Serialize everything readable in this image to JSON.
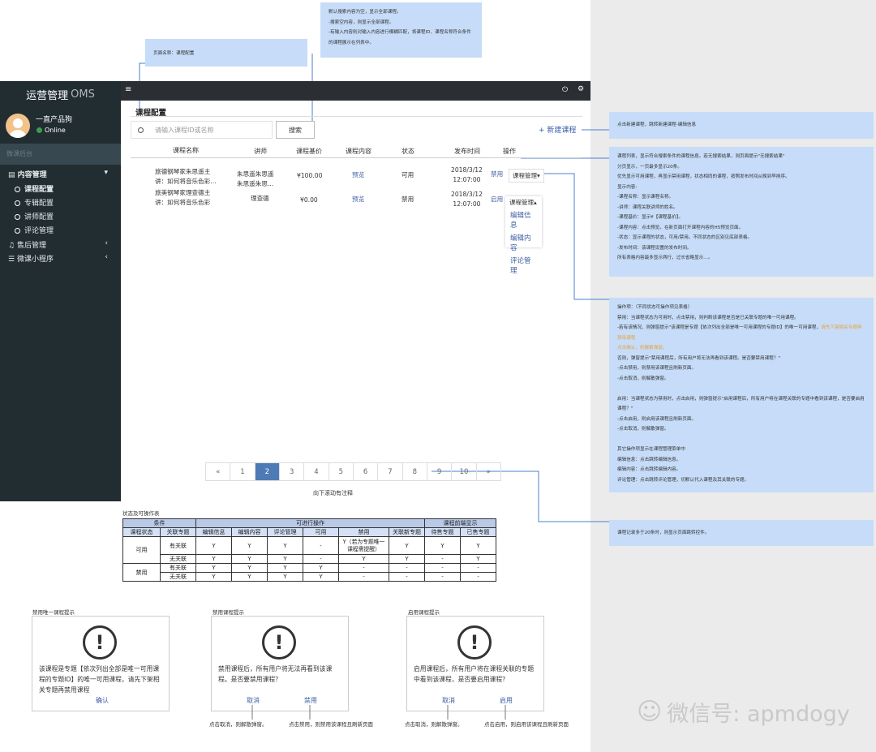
{
  "notes": {
    "search_note": "默认搜索内容为空，显示全部课程。\n-搜索空内容，则显示全部课程。\n-有输入内容则对输入内容进行模糊匹配，将课程ID、课程名称符合条件的课程展示在列表中。",
    "page_name_note": "页面名称：课程配置",
    "new_note": "点击新建课程，跳转新建课程-编辑信息",
    "list_note": "课程列表，显示符合搜索条件的课程信息。若无搜索结果，则页面提示\"无搜索结果\"\n分页显示，一页最多显示20条。\n优先显示可用课程，再显示禁用课程，状态相同的课程，按照发布时间从晚到早排序。\n显示内容:\n-课程名称：显示课程名称。\n-讲师：课程关联讲师的姓名。\n-课程基价：显示¥【课程基价】。\n-课程内容：点击预览，在新页面打开课程内容的H5预览页面。\n-状态：显示课程的状态，可用/禁用。不同状态的区别见底部表格。\n-发布时间：该课程设置的发布时间。\n所有表格内容最多显示两行，过长省略显示...。",
    "ops_note_intro": "操作项：（不同状态可操作项见表格）\n禁用：当课程状态为可用时，点击禁用，则判断该课程是否是已关联专题的唯一可用课程。\n-若有该情况，则弹窗提示\"该课程是专题【依次列出全部是唯一可用课程的专题ID】的唯一可用课程，",
    "ops_note_orange_1": "请先下架相关专题再禁用课程",
    "ops_note_orange_2": "点击确认，则解散弹窗。",
    "ops_note_rest": "否则，弹窗提示\"禁用课程后，所有用户将无法再看到该课程。是否要禁用课程？\"\n-点击禁用，则禁用该课程且刷新页面。\n-点击取消，则解散弹窗。\n\n启用：当课程状态为禁用时，点击启用，则弹窗提示\"启用课程后，所有用户将在课程关联的专题中看到该课程，是否要启用课程？\"\n-点击启用，则启用该课程且刷新页面。\n-点击取消，则解散弹窗。\n\n其它操作项显示在课程管理菜单中\n编辑信息：点击跳转编辑信息。\n编辑内容：点击跳转编辑内容。\n评论管理：点击跳转评论管理，切默认代入课程及其关联的专题。",
    "pager_note": "课程记录多于20条时，则显示页面跳转控件。"
  },
  "sidebar": {
    "brand": "运营管理",
    "brand_sub": "OMS",
    "user_name": "一直产品狗",
    "user_status": "Online",
    "search_placeholder": "微课后台",
    "group_content": "内容管理",
    "items": [
      "课程配置",
      "专辑配置",
      "讲师配置",
      "评论管理"
    ],
    "group_after_sales": "售后管理",
    "group_mini_program": "微课小程序"
  },
  "topbar": {
    "menu_icon": "≡",
    "power_icon": "⏻",
    "settings_icon": "⚙"
  },
  "page": {
    "title": "课程配置",
    "search_placeholder": "请输入课程ID或名称",
    "search_button": "搜索",
    "new_button": "+ 新建课程"
  },
  "table": {
    "headers": [
      "课程名称",
      "讲师",
      "课程基价",
      "课程内容",
      "状态",
      "发布时间",
      "操作"
    ],
    "rows": [
      {
        "name_l1": "旅德钢琴家朱思遥主",
        "name_l2": "讲：如何将音乐色彩...",
        "lecturer_l1": "朱思遥朱思遥",
        "lecturer_l2": "朱思遥朱思...",
        "price": "¥100.00",
        "content": "预览",
        "status": "可用",
        "date": "2018/3/12",
        "time": "12:07:00",
        "toggle": "禁用",
        "manage": "课程管理▾"
      },
      {
        "name_l1": "旅美钢琴家理查德主",
        "name_l2": "讲：如何将音乐色彩",
        "lecturer_l1": "理查德",
        "lecturer_l2": "",
        "price": "¥0.00",
        "content": "预览",
        "status": "禁用",
        "date": "2018/3/12",
        "time": "12:07:00",
        "toggle": "启用",
        "manage": "课程管理▴"
      }
    ],
    "manage_menu": [
      "编辑信息",
      "编辑内容",
      "评论管理"
    ]
  },
  "pagination": {
    "prev": "«",
    "pages": [
      "1",
      "2",
      "3",
      "4",
      "5",
      "6",
      "7",
      "8",
      "9",
      "10"
    ],
    "next": "»",
    "current": "2"
  },
  "scroll_hint": "向下滚动有注释",
  "state_table": {
    "title": "状态及可操作表",
    "group_headers": [
      "条件",
      "可进行操作",
      "课程前端显示"
    ],
    "col_headers": [
      "课程状态",
      "关联专题",
      "编辑信息",
      "编辑内容",
      "评论管理",
      "可用",
      "禁用",
      "关联新专题",
      "待售专题",
      "已售专题"
    ],
    "rows": [
      {
        "status": "可用",
        "assoc": "有关联",
        "cells": [
          "Y",
          "Y",
          "Y",
          "-",
          "Y（若为专题唯一课程需提醒）",
          "Y",
          "Y",
          "Y"
        ]
      },
      {
        "status": "",
        "assoc": "无关联",
        "cells": [
          "Y",
          "Y",
          "Y",
          "-",
          "Y",
          "Y",
          "-",
          "Y"
        ]
      },
      {
        "status": "禁用",
        "assoc": "有关联",
        "cells": [
          "Y",
          "Y",
          "Y",
          "Y",
          "-",
          "-",
          "-",
          "-"
        ]
      },
      {
        "status": "",
        "assoc": "无关联",
        "cells": [
          "Y",
          "Y",
          "Y",
          "Y",
          "-",
          "-",
          "-",
          "-"
        ]
      }
    ]
  },
  "dialogs": [
    {
      "label": "禁用唯一课程提示",
      "message": "该课程是专题【依次列出全部是唯一可用课程的专题ID】的唯一可用课程，请先下架相关专题再禁用课程",
      "buttons": [
        "确认"
      ],
      "captions": []
    },
    {
      "label": "禁用课程提示",
      "message": "禁用课程后，所有用户将无法再看到该课程。是否要禁用课程？",
      "buttons": [
        "取消",
        "禁用"
      ],
      "captions": [
        "点击取消，则解散弹窗。",
        "点击禁用，则禁用该课程且刷新页面"
      ]
    },
    {
      "label": "启用课程提示",
      "message": "启用课程后，所有用户将在课程关联的专题中看到该课程，是否要启用课程？",
      "buttons": [
        "取消",
        "启用"
      ],
      "captions": [
        "点击取消，则解散弹窗。",
        "点击启用，则启用该课程且刷新页面"
      ]
    }
  ],
  "watermark": "微信号: apmdogy"
}
